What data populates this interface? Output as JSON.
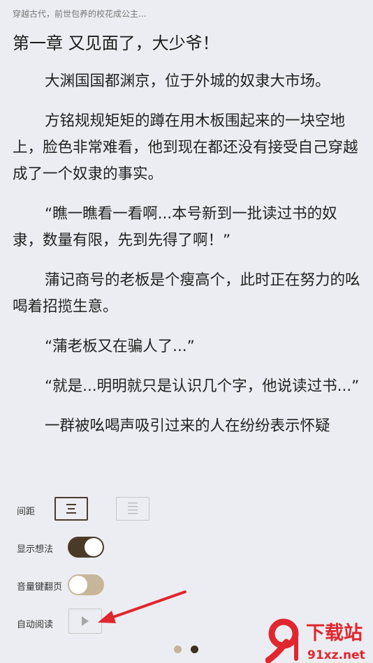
{
  "header": {
    "book_title": "穿越古代，前世包养的校花成公主..."
  },
  "chapter": {
    "title": "第一章 又见面了，大少爷！",
    "paragraphs": [
      "大渊国国都渊京，位于外城的奴隶大市场。",
      "方铭规规矩矩的蹲在用木板围起来的一块空地上，脸色非常难看，他到现在都还没有接受自己穿越成了一个奴隶的事实。",
      "“瞧一瞧看一看啊...本号新到一批读过书的奴隶，数量有限，先到先得了啊！”",
      "蒲记商号的老板是个瘦高个，此时正在努力的吆喝着招揽生意。",
      "“蒲老板又在骗人了...”",
      "“就是...明明就只是认识几个字，他说读过书...”",
      "一群被吆喝声吸引过来的人在纷纷表示怀疑"
    ]
  },
  "settings": {
    "spacing_label": "间距",
    "show_thoughts_label": "显示想法",
    "show_thoughts_on": true,
    "volume_key_label": "音量键翻页",
    "volume_key_on": false,
    "auto_read_label": "自动阅读"
  },
  "pager": {
    "pages": 2,
    "current": 2
  },
  "colors": {
    "background": "#ecedf2",
    "toggle_on": "#4a3b28",
    "toggle_off": "#c8b69a",
    "arrow": "#e0262e"
  },
  "watermark": {
    "logo_text": "下载站",
    "url_text": "91xz.net"
  }
}
